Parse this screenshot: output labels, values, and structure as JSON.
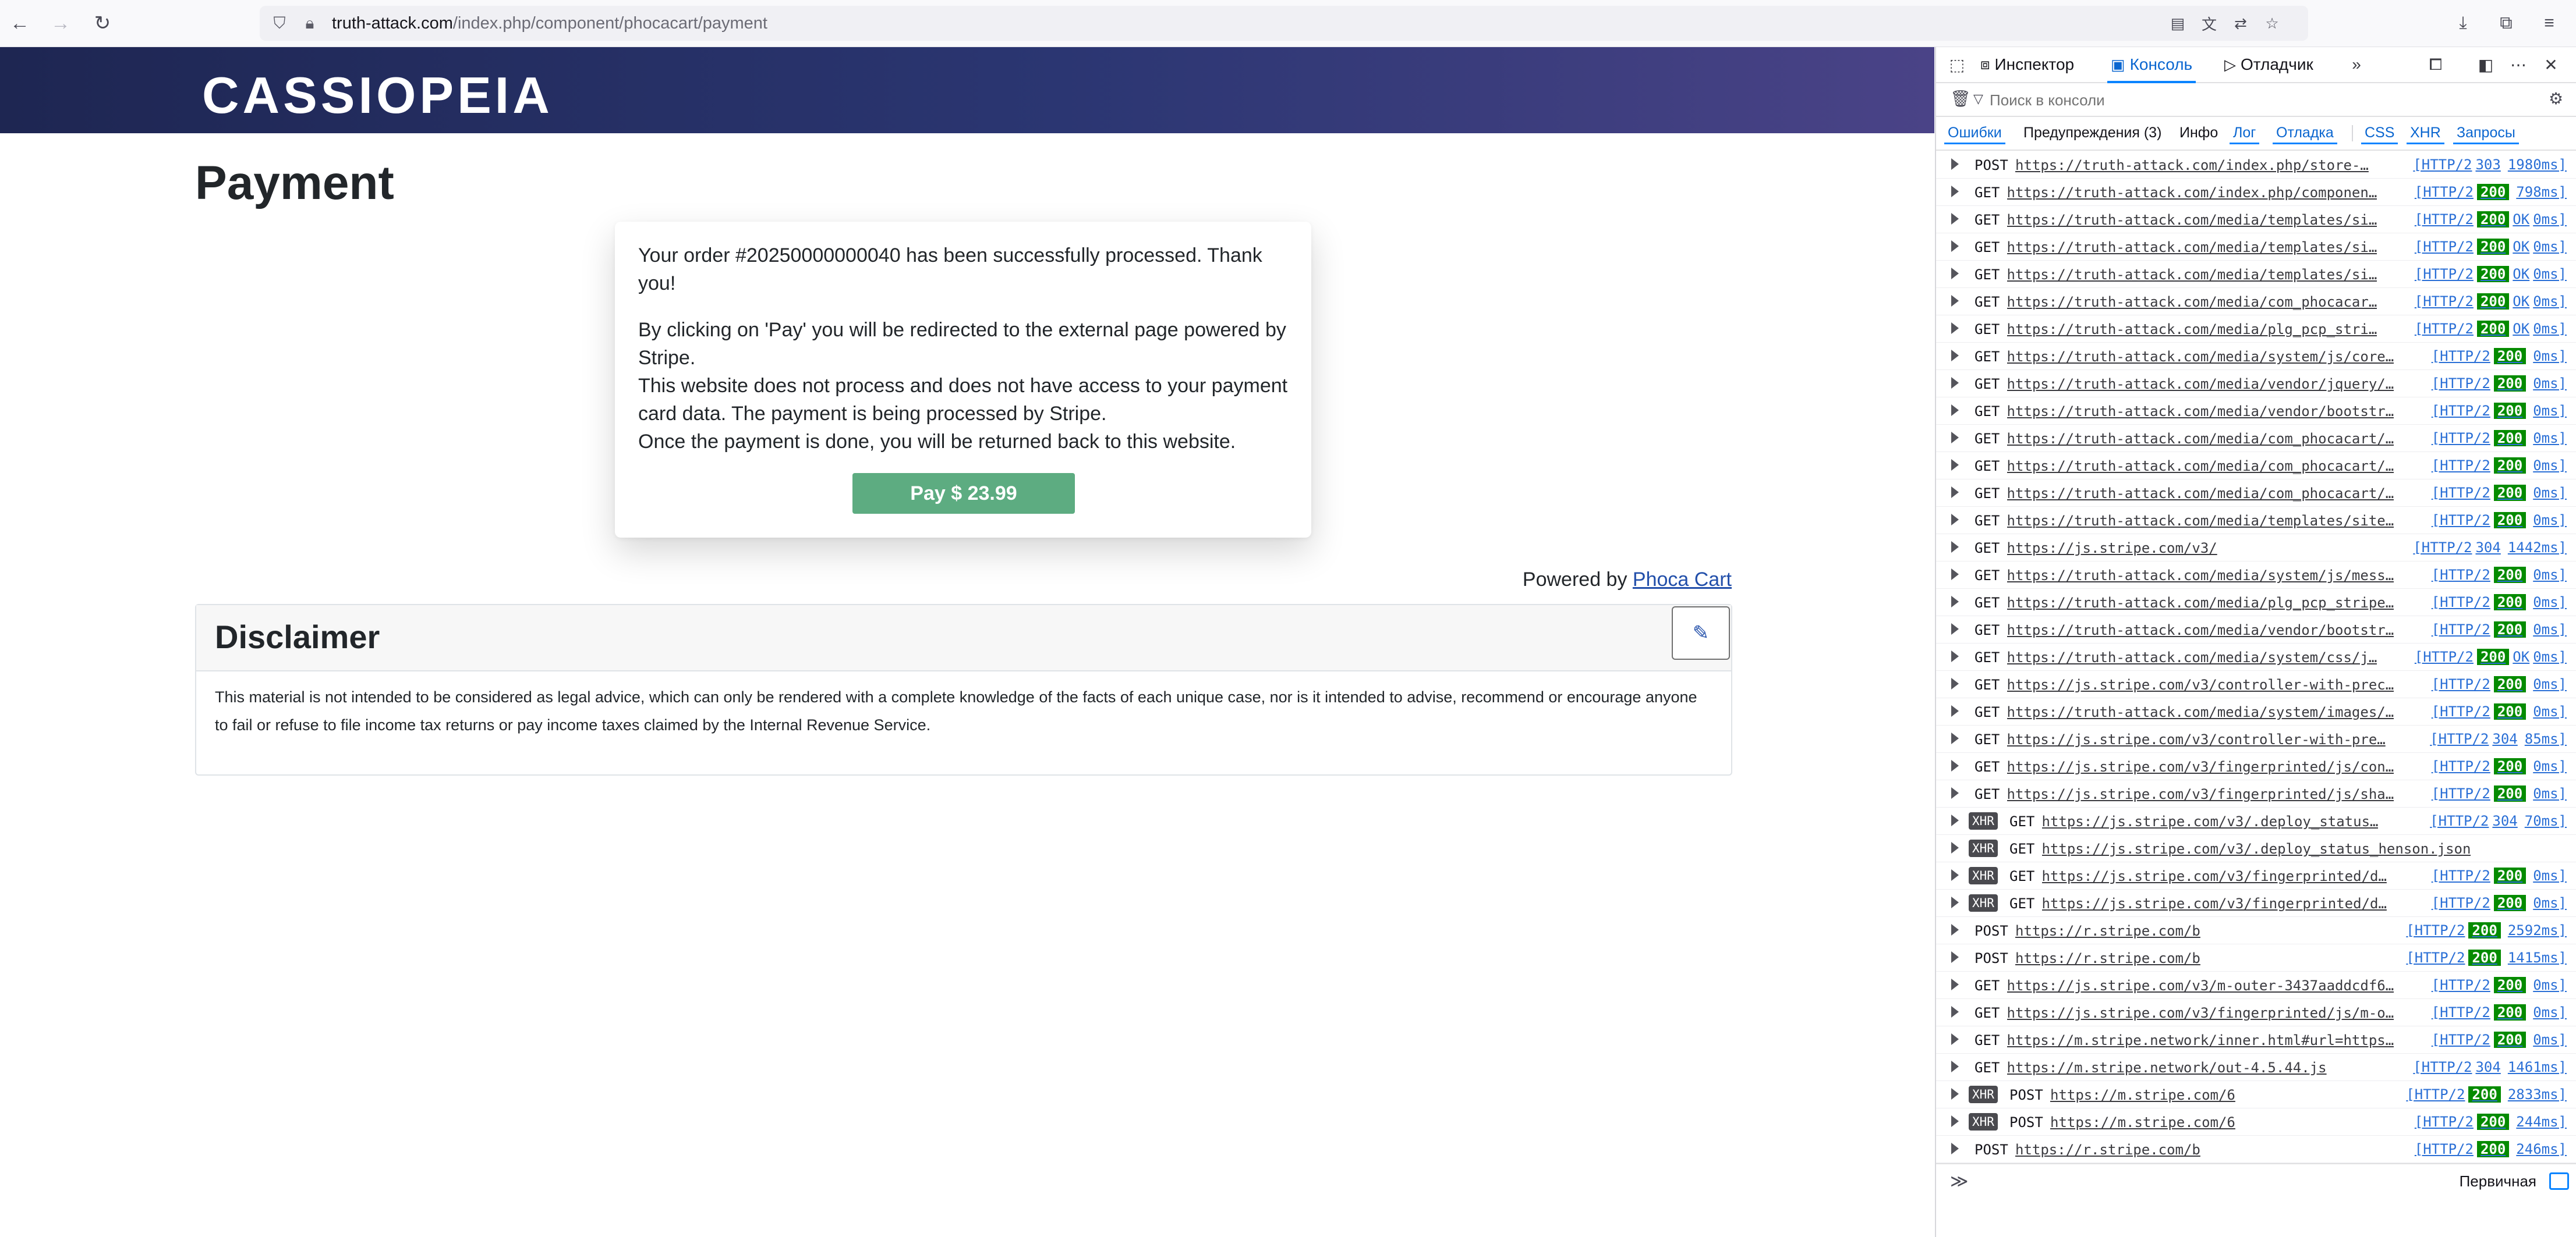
{
  "browser": {
    "url_domain": "truth-attack.com",
    "url_path": "/index.php/component/phocacart/payment"
  },
  "page": {
    "logo": "CASSIOPEIA",
    "title": "Payment",
    "message_1": "Your order #20250000000040 has been successfully processed. Thank you!",
    "message_2_lines": [
      "By clicking on 'Pay' you will be redirected to the external page powered by Stripe.",
      "This website does not process and does not have access to your payment card data. The payment is being processed by Stripe.",
      "Once the payment is done, you will be returned back to this website."
    ],
    "pay_button": "Pay $ 23.99",
    "powered_by": "Powered by",
    "powered_link": "Phoca Cart",
    "disclaimer_title": "Disclaimer",
    "disclaimer_text": "This material is not intended to be considered as legal advice, which can only be rendered with a complete knowledge of the facts of each unique case, nor is it intended to advise, recommend or encourage anyone to fail or refuse to file income tax returns or pay income taxes claimed by the Internal Revenue Service."
  },
  "devtools": {
    "tabs": [
      "Инспектор",
      "Консоль",
      "Отладчик"
    ],
    "active_tab": "Консоль",
    "filter_placeholder": "Поиск в консоли",
    "categories": [
      "Ошибки",
      "Предупреждения (3)",
      "Инфо",
      "Лог",
      "Отладка",
      "CSS",
      "XHR",
      "Запросы"
    ],
    "context": "Первичная",
    "rows": [
      {
        "xhr": false,
        "method": "POST",
        "url": "https://truth-attack.com/index.php/store-…",
        "proto": "[HTTP/2",
        "status": "303",
        "extra": "",
        "time": "1980ms]"
      },
      {
        "xhr": false,
        "method": "GET",
        "url": "https://truth-attack.com/index.php/componen…",
        "proto": "[HTTP/2",
        "status": "200",
        "extra": "",
        "time": "798ms]"
      },
      {
        "xhr": false,
        "method": "GET",
        "url": "https://truth-attack.com/media/templates/si…",
        "proto": "[HTTP/2",
        "status": "200",
        "extra": "OK",
        "time": "0ms]"
      },
      {
        "xhr": false,
        "method": "GET",
        "url": "https://truth-attack.com/media/templates/si…",
        "proto": "[HTTP/2",
        "status": "200",
        "extra": "OK",
        "time": "0ms]"
      },
      {
        "xhr": false,
        "method": "GET",
        "url": "https://truth-attack.com/media/templates/si…",
        "proto": "[HTTP/2",
        "status": "200",
        "extra": "OK",
        "time": "0ms]"
      },
      {
        "xhr": false,
        "method": "GET",
        "url": "https://truth-attack.com/media/com_phocacar…",
        "proto": "[HTTP/2",
        "status": "200",
        "extra": "OK",
        "time": "0ms]"
      },
      {
        "xhr": false,
        "method": "GET",
        "url": "https://truth-attack.com/media/plg_pcp_stri…",
        "proto": "[HTTP/2",
        "status": "200",
        "extra": "OK",
        "time": "0ms]"
      },
      {
        "xhr": false,
        "method": "GET",
        "url": "https://truth-attack.com/media/system/js/core…",
        "proto": "[HTTP/2",
        "status": "200",
        "extra": "",
        "time": "0ms]"
      },
      {
        "xhr": false,
        "method": "GET",
        "url": "https://truth-attack.com/media/vendor/jquery/…",
        "proto": "[HTTP/2",
        "status": "200",
        "extra": "",
        "time": "0ms]"
      },
      {
        "xhr": false,
        "method": "GET",
        "url": "https://truth-attack.com/media/vendor/bootstr…",
        "proto": "[HTTP/2",
        "status": "200",
        "extra": "",
        "time": "0ms]"
      },
      {
        "xhr": false,
        "method": "GET",
        "url": "https://truth-attack.com/media/com_phocacart/…",
        "proto": "[HTTP/2",
        "status": "200",
        "extra": "",
        "time": "0ms]"
      },
      {
        "xhr": false,
        "method": "GET",
        "url": "https://truth-attack.com/media/com_phocacart/…",
        "proto": "[HTTP/2",
        "status": "200",
        "extra": "",
        "time": "0ms]"
      },
      {
        "xhr": false,
        "method": "GET",
        "url": "https://truth-attack.com/media/com_phocacart/…",
        "proto": "[HTTP/2",
        "status": "200",
        "extra": "",
        "time": "0ms]"
      },
      {
        "xhr": false,
        "method": "GET",
        "url": "https://truth-attack.com/media/templates/site…",
        "proto": "[HTTP/2",
        "status": "200",
        "extra": "",
        "time": "0ms]"
      },
      {
        "xhr": false,
        "method": "GET",
        "url": "https://js.stripe.com/v3/",
        "proto": "[HTTP/2",
        "status": "304",
        "extra": "",
        "time": "1442ms]"
      },
      {
        "xhr": false,
        "method": "GET",
        "url": "https://truth-attack.com/media/system/js/mess…",
        "proto": "[HTTP/2",
        "status": "200",
        "extra": "",
        "time": "0ms]"
      },
      {
        "xhr": false,
        "method": "GET",
        "url": "https://truth-attack.com/media/plg_pcp_stripe…",
        "proto": "[HTTP/2",
        "status": "200",
        "extra": "",
        "time": "0ms]"
      },
      {
        "xhr": false,
        "method": "GET",
        "url": "https://truth-attack.com/media/vendor/bootstr…",
        "proto": "[HTTP/2",
        "status": "200",
        "extra": "",
        "time": "0ms]"
      },
      {
        "xhr": false,
        "method": "GET",
        "url": "https://truth-attack.com/media/system/css/j…",
        "proto": "[HTTP/2",
        "status": "200",
        "extra": "OK",
        "time": "0ms]"
      },
      {
        "xhr": false,
        "method": "GET",
        "url": "https://js.stripe.com/v3/controller-with-prec…",
        "proto": "[HTTP/2",
        "status": "200",
        "extra": "",
        "time": "0ms]"
      },
      {
        "xhr": false,
        "method": "GET",
        "url": "https://truth-attack.com/media/system/images/…",
        "proto": "[HTTP/2",
        "status": "200",
        "extra": "",
        "time": "0ms]"
      },
      {
        "xhr": false,
        "method": "GET",
        "url": "https://js.stripe.com/v3/controller-with-pre…",
        "proto": "[HTTP/2",
        "status": "304",
        "extra": "",
        "time": "85ms]"
      },
      {
        "xhr": false,
        "method": "GET",
        "url": "https://js.stripe.com/v3/fingerprinted/js/con…",
        "proto": "[HTTP/2",
        "status": "200",
        "extra": "",
        "time": "0ms]"
      },
      {
        "xhr": false,
        "method": "GET",
        "url": "https://js.stripe.com/v3/fingerprinted/js/sha…",
        "proto": "[HTTP/2",
        "status": "200",
        "extra": "",
        "time": "0ms]"
      },
      {
        "xhr": true,
        "method": "GET",
        "url": "https://js.stripe.com/v3/.deploy_status…",
        "proto": "[HTTP/2",
        "status": "304",
        "extra": "",
        "time": "70ms]"
      },
      {
        "xhr": true,
        "method": "GET",
        "url": "https://js.stripe.com/v3/.deploy_status_henson.json",
        "proto": "",
        "status": "",
        "extra": "",
        "time": ""
      },
      {
        "xhr": true,
        "method": "GET",
        "url": "https://js.stripe.com/v3/fingerprinted/d…",
        "proto": "[HTTP/2",
        "status": "200",
        "extra": "",
        "time": "0ms]"
      },
      {
        "xhr": true,
        "method": "GET",
        "url": "https://js.stripe.com/v3/fingerprinted/d…",
        "proto": "[HTTP/2",
        "status": "200",
        "extra": "",
        "time": "0ms]"
      },
      {
        "xhr": false,
        "method": "POST",
        "url": "https://r.stripe.com/b",
        "proto": "[HTTP/2",
        "status": "200",
        "extra": "",
        "time": "2592ms]"
      },
      {
        "xhr": false,
        "method": "POST",
        "url": "https://r.stripe.com/b",
        "proto": "[HTTP/2",
        "status": "200",
        "extra": "",
        "time": "1415ms]"
      },
      {
        "xhr": false,
        "method": "GET",
        "url": "https://js.stripe.com/v3/m-outer-3437aaddcdf6…",
        "proto": "[HTTP/2",
        "status": "200",
        "extra": "",
        "time": "0ms]"
      },
      {
        "xhr": false,
        "method": "GET",
        "url": "https://js.stripe.com/v3/fingerprinted/js/m-o…",
        "proto": "[HTTP/2",
        "status": "200",
        "extra": "",
        "time": "0ms]"
      },
      {
        "xhr": false,
        "method": "GET",
        "url": "https://m.stripe.network/inner.html#url=https…",
        "proto": "[HTTP/2",
        "status": "200",
        "extra": "",
        "time": "0ms]"
      },
      {
        "xhr": false,
        "method": "GET",
        "url": "https://m.stripe.network/out-4.5.44.js",
        "proto": "[HTTP/2",
        "status": "304",
        "extra": "",
        "time": "1461ms]"
      },
      {
        "xhr": true,
        "method": "POST",
        "url": "https://m.stripe.com/6",
        "proto": "[HTTP/2",
        "status": "200",
        "extra": "",
        "time": "2833ms]"
      },
      {
        "xhr": true,
        "method": "POST",
        "url": "https://m.stripe.com/6",
        "proto": "[HTTP/2",
        "status": "200",
        "extra": "",
        "time": "244ms]"
      },
      {
        "xhr": false,
        "method": "POST",
        "url": "https://r.stripe.com/b",
        "proto": "[HTTP/2",
        "status": "200",
        "extra": "",
        "time": "246ms]"
      }
    ]
  },
  "colors": {
    "status_ok": "#058b00",
    "accent": "#0a84ff",
    "pay_button": "#5dac81",
    "header_start": "#1e2652",
    "header_end": "#4a4387"
  }
}
